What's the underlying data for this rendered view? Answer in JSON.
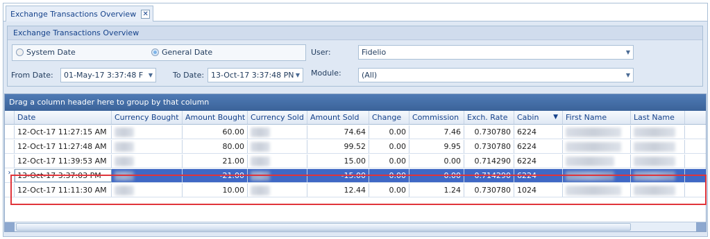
{
  "tab": {
    "title": "Exchange Transactions Overview",
    "close_glyph": "✕"
  },
  "panel": {
    "caption": "Exchange Transactions Overview",
    "radio_system": "System Date",
    "radio_general": "General Date",
    "selected_radio": "General Date",
    "from_label": "From Date:",
    "from_value": "01-May-17 3:37:48 F",
    "to_label": "To Date:",
    "to_value": "13-Oct-17 3:37:48 PN",
    "user_label": "User:",
    "user_value": "Fidelio",
    "module_label": "Module:",
    "module_value": "(All)"
  },
  "grid": {
    "group_hint": "Drag a column header here to group by that column",
    "columns": [
      "Date",
      "Currency Bought",
      "Amount Bought",
      "Currency Sold",
      "Amount Sold",
      "Change",
      "Commission",
      "Exch. Rate",
      "Cabin",
      "First Name",
      "Last Name"
    ],
    "filter_icon_column": "Cabin",
    "rows": [
      {
        "date": "12-Oct-17 11:27:15 AM",
        "amount_bought": "60.00",
        "amount_sold": "74.64",
        "change": "0.00",
        "commission": "7.46",
        "rate": "0.730780",
        "cabin": "6224",
        "selected": false
      },
      {
        "date": "12-Oct-17 11:27:48 AM",
        "amount_bought": "80.00",
        "amount_sold": "99.52",
        "change": "0.00",
        "commission": "9.95",
        "rate": "0.730780",
        "cabin": "6224",
        "selected": false
      },
      {
        "date": "12-Oct-17 11:39:53 AM",
        "amount_bought": "21.00",
        "amount_sold": "15.00",
        "change": "0.00",
        "commission": "0.00",
        "rate": "0.714290",
        "cabin": "6224",
        "selected": false
      },
      {
        "date": "13-Oct-17 3:37:03 PM",
        "amount_bought": "-21.00",
        "amount_sold": "-15.00",
        "change": "0.00",
        "commission": "0.00",
        "rate": "0.714290",
        "cabin": "6224",
        "selected": true
      },
      {
        "date": "12-Oct-17 11:11:30 AM",
        "amount_bought": "10.00",
        "amount_sold": "12.44",
        "change": "0.00",
        "commission": "1.24",
        "rate": "0.730780",
        "cabin": "1024",
        "selected": false
      }
    ],
    "row_indicator": "›"
  },
  "colors": {
    "accent": "#3f68c5",
    "highlight": "#e0343a",
    "group_bar": "#4f7ab5"
  }
}
